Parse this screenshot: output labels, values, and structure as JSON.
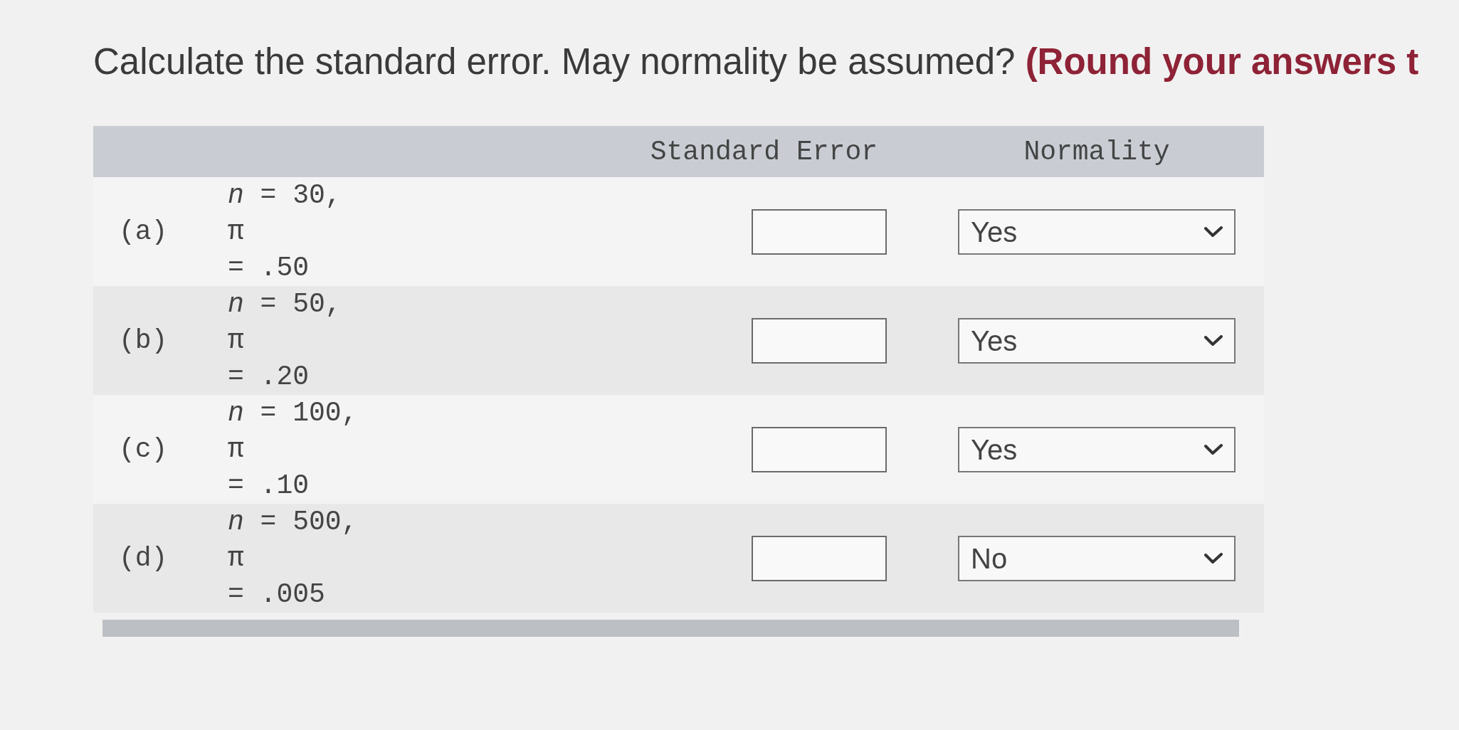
{
  "question": {
    "text": "Calculate the standard error. May normality be assumed? **(Round your answers t**"
  },
  "table": {
    "columns": [
      "Standard Error",
      "Normality"
    ],
    "rows": [
      {
        "label": "(a)",
        "parameters": [
          "*n* = 30,",
          "π",
          "= .50"
        ],
        "normality": "Yes"
      },
      {
        "label": "(b)",
        "parameters": [
          "*n* = 50,",
          "π",
          "= .20"
        ],
        "normality": "Yes"
      },
      {
        "label": "(c)",
        "parameters": [
          "*n* = 100,",
          "π",
          "= .10"
        ],
        "normality": "Yes"
      },
      {
        "label": "(d)",
        "parameters": [
          "*n* = 500,",
          "π",
          "= .005"
        ],
        "normality": "No"
      }
    ]
  }
}
